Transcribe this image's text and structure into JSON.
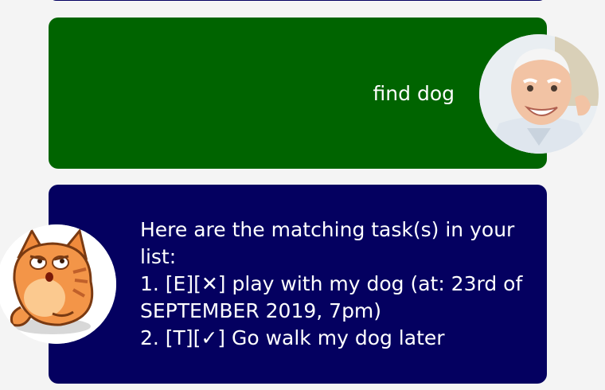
{
  "messages": [
    {
      "sender": "user",
      "text": "find dog",
      "avatar_icon": "user-photo-icon",
      "bubble_color": "#006400"
    },
    {
      "sender": "bot",
      "lines": [
        "Here are the matching task(s) in your",
        "list:",
        "1. [E][✕] play with my dog (at: 23rd of",
        "SEPTEMBER 2019, 7pm)",
        "2. [T][✓] Go walk my dog later"
      ],
      "avatar_icon": "cat-mascot-icon",
      "bubble_color": "#040060"
    }
  ]
}
